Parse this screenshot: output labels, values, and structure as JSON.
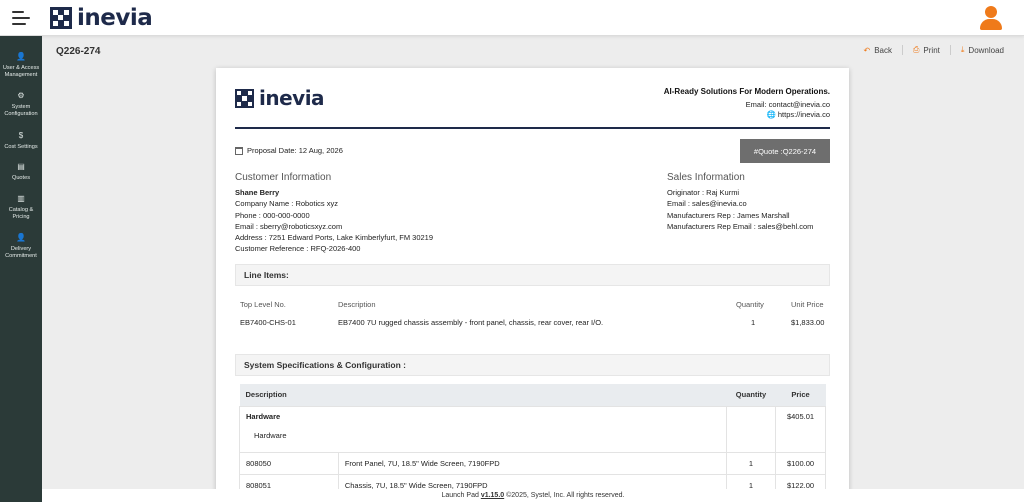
{
  "app": {
    "brand": "inevia",
    "colors": {
      "brand_navy": "#1e2a4a",
      "sidebar_bg": "#2b3a38",
      "accent_orange": "#ef7a1a",
      "badge_gray": "#6e6e6e"
    }
  },
  "sidebar": {
    "items": [
      {
        "icon": "user-icon",
        "glyph": "👤",
        "label": "User & Access Management"
      },
      {
        "icon": "gear-icon",
        "glyph": "⚙",
        "label": "System Configuration"
      },
      {
        "icon": "dollar-icon",
        "glyph": "$",
        "label": "Cost Settings"
      },
      {
        "icon": "quotes-icon",
        "glyph": "▤",
        "label": "Quotes"
      },
      {
        "icon": "catalog-icon",
        "glyph": "▥",
        "label": "Catalog & Pricing"
      },
      {
        "icon": "delivery-icon",
        "glyph": "👤",
        "label": "Delivery Commitment"
      }
    ]
  },
  "page": {
    "title": "Q226-274",
    "actions": {
      "back": "Back",
      "print": "Print",
      "download": "Download"
    }
  },
  "doc": {
    "brand": "inevia",
    "tagline": "AI-Ready Solutions For Modern Operations.",
    "email": "Email: contact@inevia.co",
    "website": "https://inevia.co",
    "proposal_date": "Proposal Date: 12 Aug, 2026",
    "quote_badge": "#Quote :Q226-274",
    "customer": {
      "heading": "Customer Information",
      "name": "Shane Berry",
      "company": "Company Name : Robotics xyz",
      "phone": "Phone : 000-000-0000",
      "email": "Email : sberry@roboticsxyz.com",
      "address": "Address : 7251 Edward Ports, Lake Kimberlyfurt, FM 30219",
      "reference": "Customer Reference : RFQ-2026-400"
    },
    "sales": {
      "heading": "Sales Information",
      "originator": "Originator : Raj Kurmi",
      "email": "Email : sales@inevia.co",
      "rep": "Manufacturers Rep : James Marshall",
      "rep_email": "Manufacturers Rep Email : sales@behl.com"
    },
    "line_items": {
      "section_title": "Line Items:",
      "headers": {
        "top_level": "Top Level No.",
        "description": "Description",
        "quantity": "Quantity",
        "unit_price": "Unit Price"
      },
      "rows": [
        {
          "top_level": "EB7400-CHS-01",
          "description": "EB7400 7U rugged chassis assembly - front panel, chassis, rear cover, rear I/O.",
          "quantity": "1",
          "unit_price": "$1,833.00"
        }
      ]
    },
    "specs": {
      "section_title": "System Specifications & Configuration :",
      "headers": {
        "description": "Description",
        "quantity": "Quantity",
        "price": "Price"
      },
      "group": {
        "name": "Hardware",
        "sub": "Hardware",
        "price": "$405.01"
      },
      "rows": [
        {
          "part": "808050",
          "description": "Front Panel, 7U, 18.5\" Wide Screen, 7190FPD",
          "quantity": "1",
          "price": "$100.00"
        },
        {
          "part": "808051",
          "description": "Chassis, 7U, 18.5\" Wide Screen, 7190FPD",
          "quantity": "1",
          "price": "$122.00"
        }
      ]
    }
  },
  "footer": {
    "prefix": "Launch Pad",
    "version": "v1.15.0",
    "suffix": "©2025, Systel, Inc. All rights reserved."
  }
}
